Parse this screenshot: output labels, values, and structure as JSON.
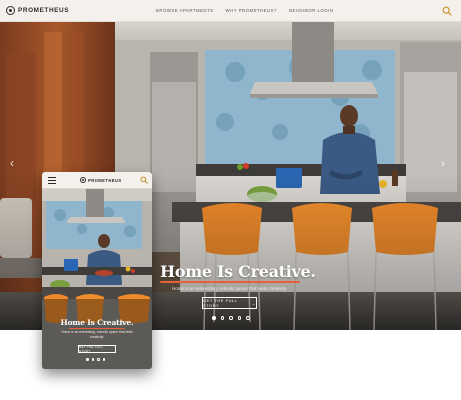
{
  "brand": {
    "name": "PROMETHEUS",
    "accent": "#e8603a"
  },
  "nav": {
    "links": [
      "BROWSE APARTMENTS",
      "WHY PROMETHEUS?",
      "NEIGHBOR LOGIN"
    ],
    "search_icon": "search-icon"
  },
  "hero": {
    "title": "Home Is Creative.",
    "subtitle": "Home is an interesting, eclectic space that feels creativity.",
    "cta_label": "GET THE FULL STORY",
    "cta_icon": "arrow-right-icon",
    "slides_total": 5,
    "slide_active": 1
  },
  "mobile": {
    "brand": "PROMETHEUS",
    "menu_icon": "hamburger-icon",
    "title": "Home Is Creative.",
    "subtitle": "Home is an interesting, eclectic space that feels creativity.",
    "cta_label": "GET THE FULL STORY"
  }
}
